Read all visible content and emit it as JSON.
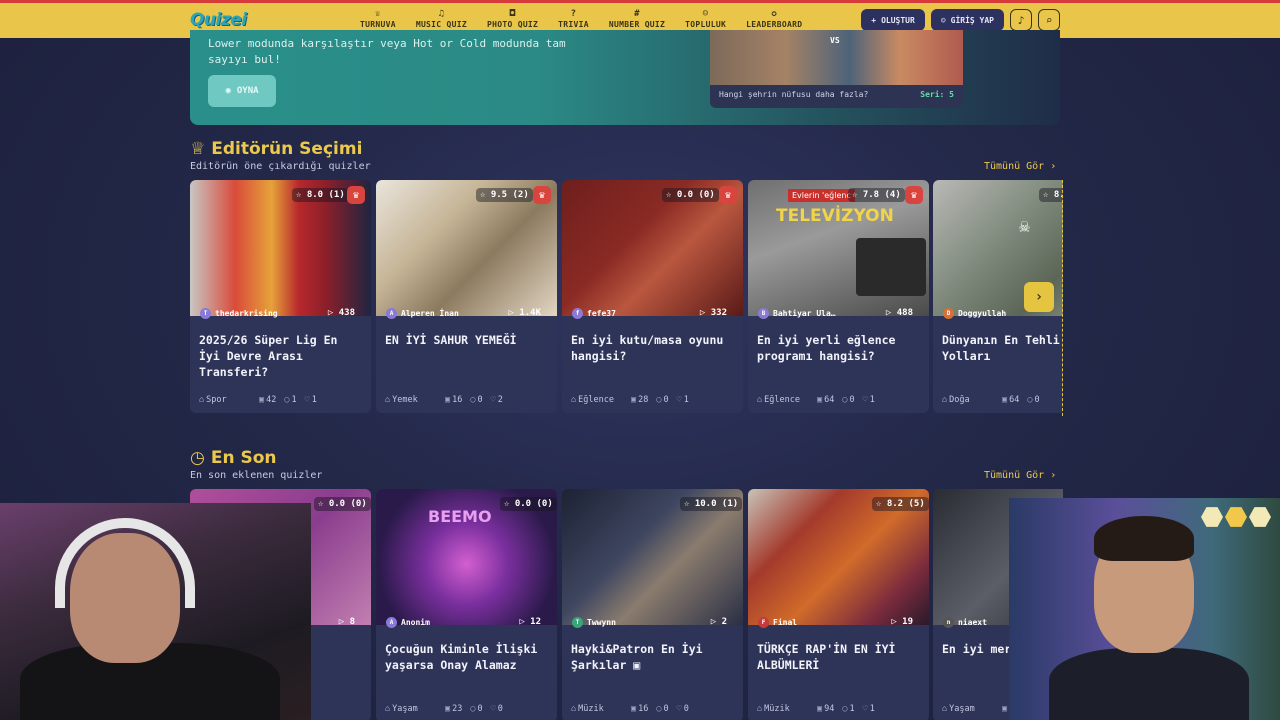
{
  "app": {
    "logo": "Quizei"
  },
  "nav": {
    "items": [
      {
        "label": "TURNUVA",
        "icon": "trophy-icon",
        "glyph": "♕"
      },
      {
        "label": "MUSIC QUIZ",
        "icon": "music-icon",
        "glyph": "♫"
      },
      {
        "label": "PHOTO QUIZ",
        "icon": "camera-icon",
        "glyph": "◘"
      },
      {
        "label": "TRIVIA",
        "icon": "question-icon",
        "glyph": "?"
      },
      {
        "label": "NUMBER QUIZ",
        "icon": "hash-icon",
        "glyph": "#"
      },
      {
        "label": "TOPLULUK",
        "icon": "users-icon",
        "glyph": "☺"
      },
      {
        "label": "LEADERBOARD",
        "icon": "medal-icon",
        "glyph": "✪"
      }
    ],
    "create_label": "OLUŞTUR",
    "login_label": "GİRİŞ YAP"
  },
  "hero": {
    "text": "Lower modunda karşılaştır veya Hot or Cold modunda tam sayıyı bul!",
    "play_label": "OYNA",
    "card": {
      "vs": "VS",
      "question": "Hangi şehrin nüfusu daha fazla?",
      "streak": "Seri: 5"
    }
  },
  "editors": {
    "title": "Editörün Seçimi",
    "subtitle": "Editörün öne çıkardığı quizler",
    "see_all": "Tümünü Gör ›",
    "cards": [
      {
        "rating": "☆ 8.0 (1)",
        "author": "thedarkrising",
        "plays": "▷ 438",
        "title": "2025/26 Süper Lig En İyi Devre Arası Transferi?",
        "category": "Spor",
        "questions": "42",
        "comments": "1",
        "likes": "1",
        "crown": true
      },
      {
        "rating": "☆ 9.5 (2)",
        "author": "Alperen İnan",
        "plays": "▷ 1.4K",
        "title": "EN İYİ SAHUR YEMEĞİ",
        "category": "Yemek",
        "questions": "16",
        "comments": "0",
        "likes": "2",
        "crown": true
      },
      {
        "rating": "☆ 0.0 (0)",
        "author": "fefe37",
        "plays": "▷ 332",
        "title": "En iyi kutu/masa oyunu hangisi?",
        "category": "Eğlence",
        "questions": "28",
        "comments": "0",
        "likes": "1",
        "crown": true
      },
      {
        "rating": "☆ 7.8 (4)",
        "author": "Bahtiyar Ula…",
        "plays": "▷ 488",
        "title": "En iyi yerli eğlence programı hangisi?",
        "category": "Eğlence",
        "questions": "64",
        "comments": "0",
        "likes": "1",
        "crown": true,
        "tag": "Evlerin 'eğlenc",
        "overlay": "TELEVİZYON"
      },
      {
        "rating": "☆ 8.",
        "author": "Doggyullah",
        "plays": "",
        "title": "Dünyanın En Tehli Yolları",
        "category": "Doğa",
        "questions": "64",
        "comments": "0",
        "likes": "",
        "crown": false
      }
    ]
  },
  "latest": {
    "title": "En Son",
    "subtitle": "En son eklenen quizler",
    "see_all": "Tümünü Gör ›",
    "cards": [
      {
        "rating": "☆ 0.0 (0)",
        "author": "",
        "plays": "▷ 8",
        "title": "ap",
        "category": "",
        "questions": "",
        "comments": "0",
        "likes": "0"
      },
      {
        "rating": "☆ 0.0 (0)",
        "author": "Anonim",
        "plays": "▷ 12",
        "title": "Çocuğun Kiminle İlişki yaşarsa Onay Alamaz",
        "category": "Yaşam",
        "questions": "23",
        "comments": "0",
        "likes": "0",
        "overlay": "BEEMO"
      },
      {
        "rating": "☆ 10.0 (1)",
        "author": "Twwynn",
        "plays": "▷ 2",
        "title": "Hayki&Patron En İyi Şarkılar ▣",
        "category": "Müzik",
        "questions": "16",
        "comments": "0",
        "likes": "0"
      },
      {
        "rating": "☆ 8.2 (5)",
        "author": "Final",
        "plays": "▷ 19",
        "title": "TÜRKÇE RAP'İN EN İYİ ALBÜMLERİ",
        "category": "Müzik",
        "questions": "94",
        "comments": "1",
        "likes": "1"
      },
      {
        "rating": "",
        "author": "niaext",
        "plays": "",
        "title": "En iyi mer",
        "category": "Yaşam",
        "questions": "64",
        "comments": "",
        "likes": ""
      }
    ]
  },
  "colors": {
    "accent": "#ecc94b",
    "navbar": "#e9c64a",
    "card_bg": "#2e3458",
    "crown": "#d8453e",
    "teal": "#2a8f8a"
  }
}
